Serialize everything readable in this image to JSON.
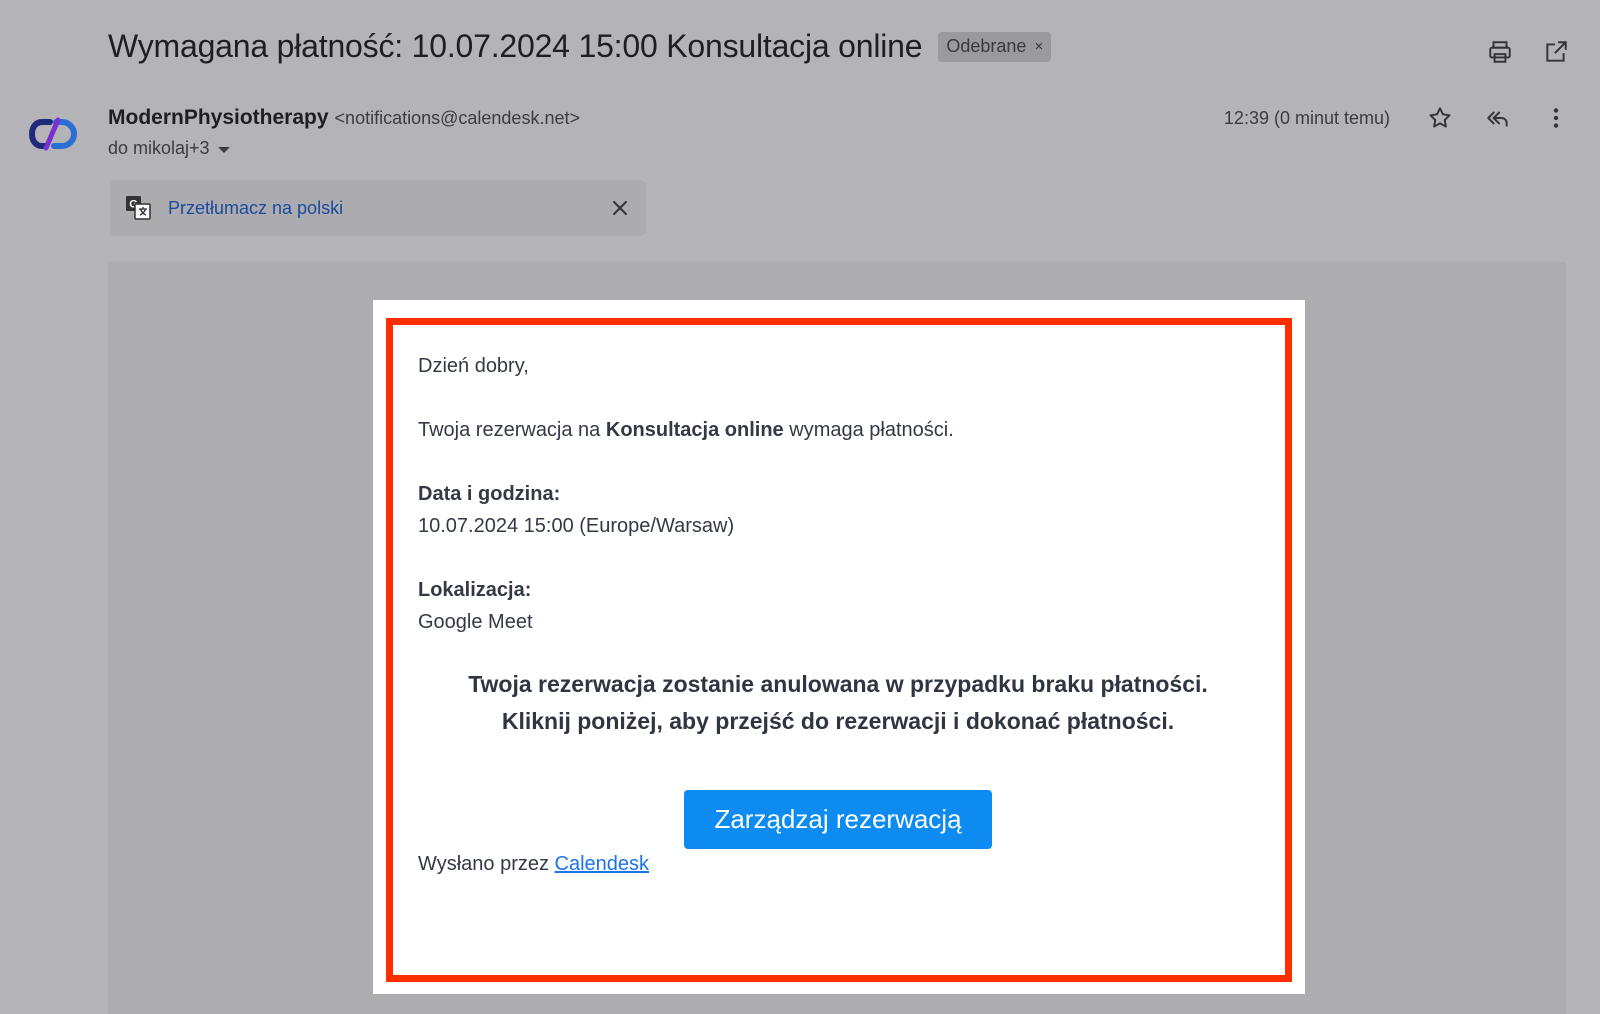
{
  "header": {
    "subject": "Wymagana płatność: 10.07.2024 15:00 Konsultacja online",
    "label_chip": "Odebrane",
    "label_close": "×"
  },
  "sender": {
    "name": "ModernPhysiotherapy",
    "email": "<notifications@calendesk.net>",
    "recipients": "do mikolaj+3",
    "time": "12:39 (0 minut temu)"
  },
  "translate": {
    "link": "Przetłumacz na polski"
  },
  "email_body": {
    "greeting": "Dzień dobry,",
    "intro_prefix": "Twoja rezerwacja na ",
    "intro_bold": "Konsultacja online",
    "intro_suffix": " wymaga płatności.",
    "date_label": "Data i godzina:",
    "date_value": "10.07.2024 15:00 (Europe/Warsaw)",
    "location_label": "Lokalizacja:",
    "location_value": "Google Meet",
    "warning_line1": "Twoja rezerwacja zostanie anulowana w przypadku braku płatności.",
    "warning_line2": "Kliknij poniżej, aby przejść do rezerwacji i dokonać płatności.",
    "button_label": "Zarządzaj rezerwacją",
    "footer_prefix": "Wysłano przez ",
    "footer_link": "Calendesk"
  },
  "colors": {
    "highlight_border": "#ff2e00",
    "button_bg": "#0d8bf0",
    "link": "#1a73e8"
  },
  "icons": [
    "print-icon",
    "open-in-new-window-icon",
    "star-icon",
    "reply-all-icon",
    "more-vertical-icon",
    "translate-icon",
    "close-icon",
    "chevron-down-icon"
  ]
}
